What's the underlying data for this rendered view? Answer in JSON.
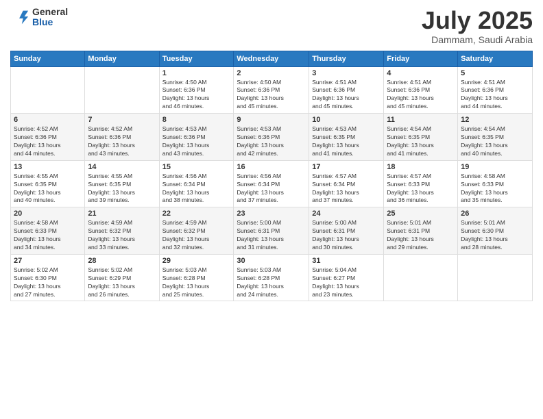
{
  "logo": {
    "general": "General",
    "blue": "Blue"
  },
  "header": {
    "month": "July 2025",
    "location": "Dammam, Saudi Arabia"
  },
  "weekdays": [
    "Sunday",
    "Monday",
    "Tuesday",
    "Wednesday",
    "Thursday",
    "Friday",
    "Saturday"
  ],
  "weeks": [
    [
      {
        "day": "",
        "info": ""
      },
      {
        "day": "",
        "info": ""
      },
      {
        "day": "1",
        "info": "Sunrise: 4:50 AM\nSunset: 6:36 PM\nDaylight: 13 hours\nand 46 minutes."
      },
      {
        "day": "2",
        "info": "Sunrise: 4:50 AM\nSunset: 6:36 PM\nDaylight: 13 hours\nand 45 minutes."
      },
      {
        "day": "3",
        "info": "Sunrise: 4:51 AM\nSunset: 6:36 PM\nDaylight: 13 hours\nand 45 minutes."
      },
      {
        "day": "4",
        "info": "Sunrise: 4:51 AM\nSunset: 6:36 PM\nDaylight: 13 hours\nand 45 minutes."
      },
      {
        "day": "5",
        "info": "Sunrise: 4:51 AM\nSunset: 6:36 PM\nDaylight: 13 hours\nand 44 minutes."
      }
    ],
    [
      {
        "day": "6",
        "info": "Sunrise: 4:52 AM\nSunset: 6:36 PM\nDaylight: 13 hours\nand 44 minutes."
      },
      {
        "day": "7",
        "info": "Sunrise: 4:52 AM\nSunset: 6:36 PM\nDaylight: 13 hours\nand 43 minutes."
      },
      {
        "day": "8",
        "info": "Sunrise: 4:53 AM\nSunset: 6:36 PM\nDaylight: 13 hours\nand 43 minutes."
      },
      {
        "day": "9",
        "info": "Sunrise: 4:53 AM\nSunset: 6:36 PM\nDaylight: 13 hours\nand 42 minutes."
      },
      {
        "day": "10",
        "info": "Sunrise: 4:53 AM\nSunset: 6:35 PM\nDaylight: 13 hours\nand 41 minutes."
      },
      {
        "day": "11",
        "info": "Sunrise: 4:54 AM\nSunset: 6:35 PM\nDaylight: 13 hours\nand 41 minutes."
      },
      {
        "day": "12",
        "info": "Sunrise: 4:54 AM\nSunset: 6:35 PM\nDaylight: 13 hours\nand 40 minutes."
      }
    ],
    [
      {
        "day": "13",
        "info": "Sunrise: 4:55 AM\nSunset: 6:35 PM\nDaylight: 13 hours\nand 40 minutes."
      },
      {
        "day": "14",
        "info": "Sunrise: 4:55 AM\nSunset: 6:35 PM\nDaylight: 13 hours\nand 39 minutes."
      },
      {
        "day": "15",
        "info": "Sunrise: 4:56 AM\nSunset: 6:34 PM\nDaylight: 13 hours\nand 38 minutes."
      },
      {
        "day": "16",
        "info": "Sunrise: 4:56 AM\nSunset: 6:34 PM\nDaylight: 13 hours\nand 37 minutes."
      },
      {
        "day": "17",
        "info": "Sunrise: 4:57 AM\nSunset: 6:34 PM\nDaylight: 13 hours\nand 37 minutes."
      },
      {
        "day": "18",
        "info": "Sunrise: 4:57 AM\nSunset: 6:33 PM\nDaylight: 13 hours\nand 36 minutes."
      },
      {
        "day": "19",
        "info": "Sunrise: 4:58 AM\nSunset: 6:33 PM\nDaylight: 13 hours\nand 35 minutes."
      }
    ],
    [
      {
        "day": "20",
        "info": "Sunrise: 4:58 AM\nSunset: 6:33 PM\nDaylight: 13 hours\nand 34 minutes."
      },
      {
        "day": "21",
        "info": "Sunrise: 4:59 AM\nSunset: 6:32 PM\nDaylight: 13 hours\nand 33 minutes."
      },
      {
        "day": "22",
        "info": "Sunrise: 4:59 AM\nSunset: 6:32 PM\nDaylight: 13 hours\nand 32 minutes."
      },
      {
        "day": "23",
        "info": "Sunrise: 5:00 AM\nSunset: 6:31 PM\nDaylight: 13 hours\nand 31 minutes."
      },
      {
        "day": "24",
        "info": "Sunrise: 5:00 AM\nSunset: 6:31 PM\nDaylight: 13 hours\nand 30 minutes."
      },
      {
        "day": "25",
        "info": "Sunrise: 5:01 AM\nSunset: 6:31 PM\nDaylight: 13 hours\nand 29 minutes."
      },
      {
        "day": "26",
        "info": "Sunrise: 5:01 AM\nSunset: 6:30 PM\nDaylight: 13 hours\nand 28 minutes."
      }
    ],
    [
      {
        "day": "27",
        "info": "Sunrise: 5:02 AM\nSunset: 6:30 PM\nDaylight: 13 hours\nand 27 minutes."
      },
      {
        "day": "28",
        "info": "Sunrise: 5:02 AM\nSunset: 6:29 PM\nDaylight: 13 hours\nand 26 minutes."
      },
      {
        "day": "29",
        "info": "Sunrise: 5:03 AM\nSunset: 6:28 PM\nDaylight: 13 hours\nand 25 minutes."
      },
      {
        "day": "30",
        "info": "Sunrise: 5:03 AM\nSunset: 6:28 PM\nDaylight: 13 hours\nand 24 minutes."
      },
      {
        "day": "31",
        "info": "Sunrise: 5:04 AM\nSunset: 6:27 PM\nDaylight: 13 hours\nand 23 minutes."
      },
      {
        "day": "",
        "info": ""
      },
      {
        "day": "",
        "info": ""
      }
    ]
  ]
}
